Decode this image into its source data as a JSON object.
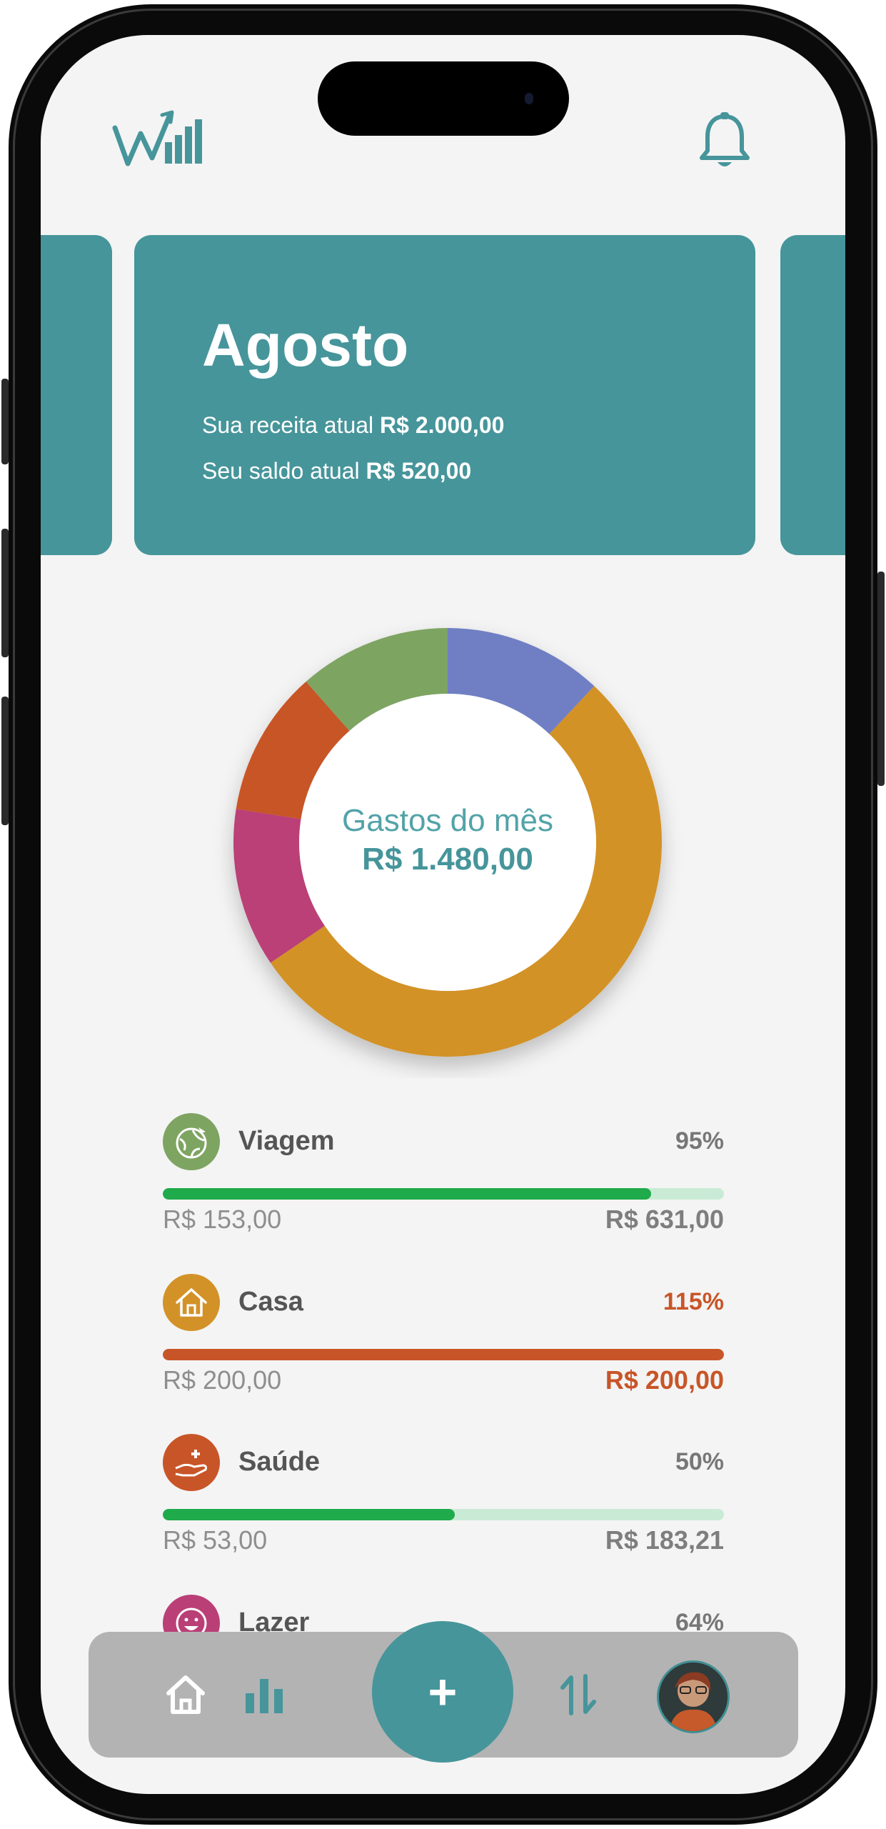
{
  "card": {
    "month": "Agosto",
    "income_label": "Sua receita atual",
    "income_value": "R$ 2.000,00",
    "balance_label": "Seu saldo atual",
    "balance_value": "R$ 520,00"
  },
  "donut": {
    "label": "Gastos do mês",
    "value": "R$ 1.480,00"
  },
  "chart_data": {
    "type": "pie",
    "categories": [
      "Azul",
      "Laranja",
      "Rosa",
      "Vermelho",
      "Verde"
    ],
    "values": [
      12,
      53.5,
      12,
      11,
      11.5
    ],
    "colors": [
      "#6f7fc4",
      "#d39228",
      "#ba3f77",
      "#c85528",
      "#7ea462"
    ],
    "title": "Gastos do mês",
    "center_text": "R$ 1.480,00"
  },
  "categories": [
    {
      "name": "Viagem",
      "percent": "95%",
      "spent": "R$ 153,00",
      "budget": "R$ 631,00",
      "fill": 0.87,
      "bar_color": "#1faa4b",
      "icon": "globe-icon",
      "icon_color": "#7ea462",
      "warn": false
    },
    {
      "name": "Casa",
      "percent": "115%",
      "spent": "R$ 200,00",
      "budget": "R$ 200,00",
      "fill": 1.0,
      "bar_color": "#c85528",
      "icon": "house-icon",
      "icon_color": "#d39228",
      "warn": true
    },
    {
      "name": "Saúde",
      "percent": "50%",
      "spent": "R$ 53,00",
      "budget": "R$ 183,21",
      "fill": 0.52,
      "bar_color": "#1faa4b",
      "icon": "health-hand-icon",
      "icon_color": "#c85528",
      "warn": false
    },
    {
      "name": "Lazer",
      "percent": "64%",
      "icon": "smile-icon",
      "icon_color": "#ba3f77"
    }
  ],
  "nav": {
    "fab_label": "+",
    "items": [
      "home-icon",
      "bar-chart-icon",
      "add-button",
      "transfer-arrows-icon",
      "avatar"
    ]
  },
  "colors": {
    "accent": "#46959b",
    "background": "#f4f4f4",
    "warning": "#c85528",
    "progress": "#1faa4b"
  }
}
